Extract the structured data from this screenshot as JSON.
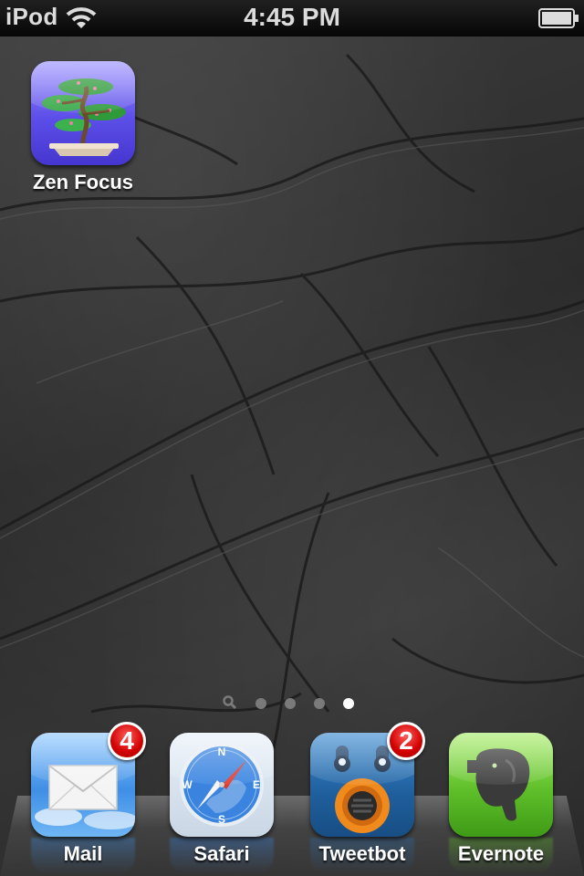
{
  "status_bar": {
    "carrier": "iPod",
    "time": "4:45 PM",
    "wifi_icon": "wifi-icon",
    "battery_icon": "battery-icon"
  },
  "home_screen": {
    "apps": [
      {
        "name": "Zen Focus",
        "icon": "bonsai-tree-icon"
      }
    ]
  },
  "page_indicator": {
    "pages": 4,
    "current_page": 4,
    "search_icon": "spotlight-search-icon"
  },
  "dock": {
    "apps": [
      {
        "name": "Mail",
        "icon": "envelope-icon",
        "badge": "4"
      },
      {
        "name": "Safari",
        "icon": "compass-icon",
        "badge": ""
      },
      {
        "name": "Tweetbot",
        "icon": "robot-bird-icon",
        "badge": "2"
      },
      {
        "name": "Evernote",
        "icon": "elephant-icon",
        "badge": ""
      }
    ]
  },
  "colors": {
    "badge_red": "#d10000",
    "zen_tile": "#6a5cf0",
    "mail_tile": "#3f8fe6",
    "safari_tile": "#3a84e0",
    "tweetbot_tile": "#2a6fb0",
    "evernote_tile": "#5fbf2a"
  }
}
